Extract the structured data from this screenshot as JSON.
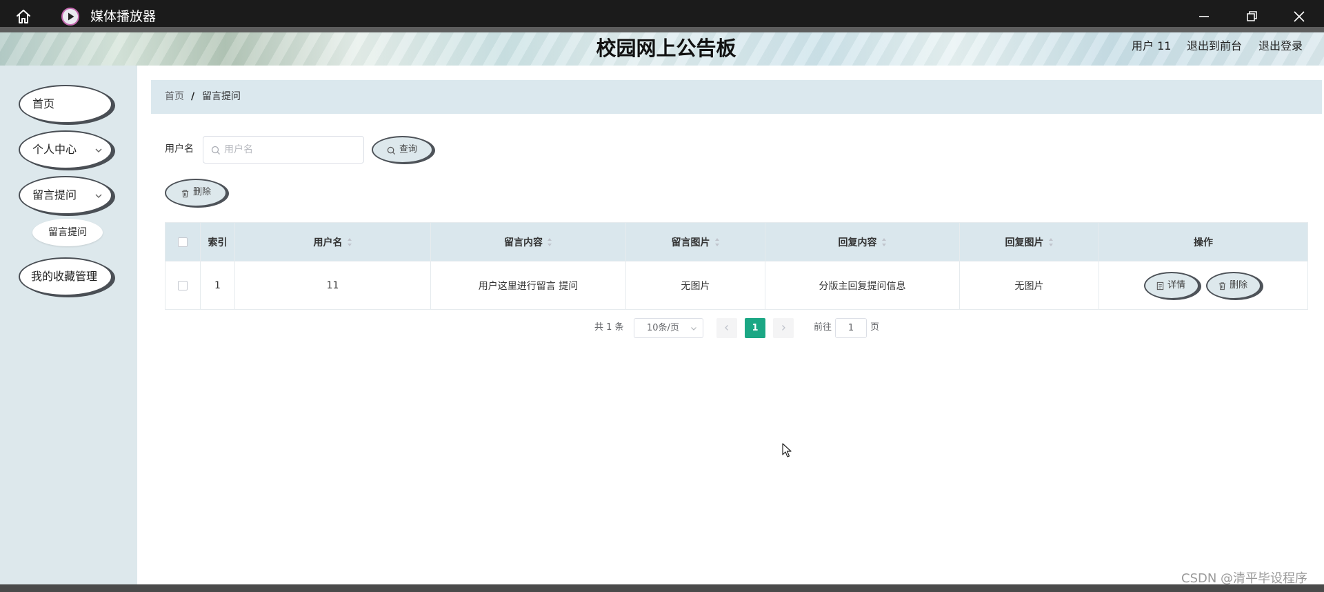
{
  "window": {
    "app_title": "媒体播放器"
  },
  "header": {
    "site_title": "校园网上公告板",
    "user_label": "用户 11",
    "back_to_front": "退出到前台",
    "logout": "退出登录"
  },
  "sidebar": {
    "items": [
      {
        "label": "首页",
        "has_submenu": false
      },
      {
        "label": "个人中心",
        "has_submenu": true
      },
      {
        "label": "留言提问",
        "has_submenu": true
      },
      {
        "label": "我的收藏管理",
        "has_submenu": false
      }
    ],
    "subitem": "留言提问"
  },
  "breadcrumb": {
    "home": "首页",
    "separator": "/",
    "current": "留言提问"
  },
  "search": {
    "label": "用户名",
    "placeholder": "用户名",
    "value": "",
    "query_button": "查询"
  },
  "toolbar": {
    "delete_button": "删除"
  },
  "table": {
    "columns": [
      "索引",
      "用户名",
      "留言内容",
      "留言图片",
      "回复内容",
      "回复图片",
      "操作"
    ],
    "rows": [
      {
        "index": "1",
        "username": "11",
        "content": "用户这里进行留言 提问",
        "image": "无图片",
        "reply": "分版主回复提问信息",
        "reply_image": "无图片",
        "actions": [
          "详情",
          "删除"
        ]
      }
    ]
  },
  "pagination": {
    "total": "共 1 条",
    "page_size": "10条/页",
    "current_page": "1",
    "goto_label": "前往",
    "goto_value": "1",
    "page_unit": "页"
  },
  "watermark": "CSDN @清平毕设程序",
  "colors": {
    "accent": "#1ba784",
    "sidebar_bg": "#dde8ec",
    "table_header_bg": "#dae7ed"
  }
}
